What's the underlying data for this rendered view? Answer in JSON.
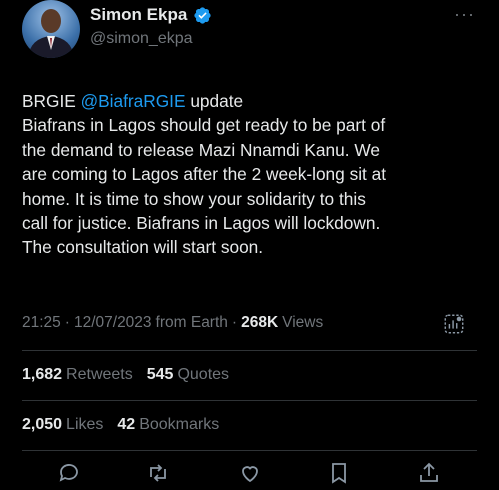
{
  "author": {
    "display_name": "Simon Ekpa",
    "handle": "@simon_ekpa",
    "verified": true
  },
  "menu": {
    "more_label": "···"
  },
  "tweet": {
    "lines": [
      {
        "before": "BRGIE ",
        "mention": "@BiafraRGIE",
        "after": " update"
      },
      {
        "text": "Biafrans in Lagos should get ready to be part of"
      },
      {
        "text": "the demand to release Mazi Nnamdi Kanu. We"
      },
      {
        "text": "are coming to Lagos after the 2 week-long sit at"
      },
      {
        "text": "home. It is time to show your solidarity to this"
      },
      {
        "text": "call for justice. Biafrans in Lagos will lockdown."
      },
      {
        "text": "The consultation will start soon."
      }
    ]
  },
  "meta": {
    "time": "21:25",
    "date": "12/07/2023",
    "source": "from Earth",
    "dot": "·",
    "views_count": "268K",
    "views_label": "Views"
  },
  "stats": {
    "retweets_count": "1,682",
    "retweets_label": "Retweets",
    "quotes_count": "545",
    "quotes_label": "Quotes",
    "likes_count": "2,050",
    "likes_label": "Likes",
    "bookmarks_count": "42",
    "bookmarks_label": "Bookmarks"
  },
  "colors": {
    "background": "#000000",
    "text": "#e7e9ea",
    "muted": "#71767b",
    "accent": "#1d9bf0",
    "divider": "#2f3336"
  },
  "icons": [
    "verified-badge-icon",
    "more-options-icon",
    "analytics-icon",
    "reply-icon",
    "retweet-icon",
    "like-icon",
    "bookmark-icon",
    "share-icon"
  ]
}
